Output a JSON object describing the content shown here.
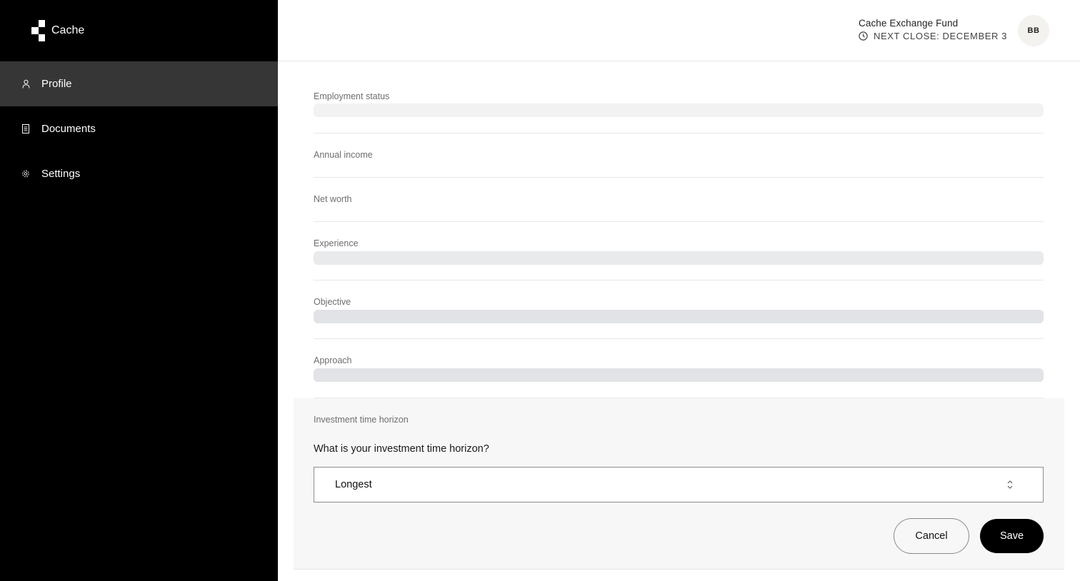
{
  "app": {
    "name": "Cache"
  },
  "sidebar": {
    "items": [
      {
        "label": "Profile",
        "icon": "person-icon",
        "active": true
      },
      {
        "label": "Documents",
        "icon": "document-icon",
        "active": false
      },
      {
        "label": "Settings",
        "icon": "gear-icon",
        "active": false
      }
    ]
  },
  "header": {
    "fund_name": "Cache Exchange Fund",
    "next_close": "NEXT CLOSE: DECEMBER 3",
    "avatar_initials": "BB"
  },
  "form": {
    "fields": [
      {
        "label": "Employment status",
        "loading": true
      },
      {
        "label": "Annual income",
        "loading": false
      },
      {
        "label": "Net worth",
        "loading": false
      },
      {
        "label": "Experience",
        "loading": true
      },
      {
        "label": "Objective",
        "loading": true
      },
      {
        "label": "Approach",
        "loading": true
      }
    ],
    "editing": {
      "label": "Investment time horizon",
      "question": "What is your investment time horizon?",
      "selected_value": "Longest",
      "cancel_label": "Cancel",
      "save_label": "Save"
    }
  },
  "colors": {
    "sidebar_bg": "#000000",
    "sidebar_active": "#363636",
    "skeleton_light": "#f2f2f2",
    "skeleton_dark": "#e1e3e6",
    "panel_bg": "#f7f7f7",
    "primary_button": "#000000"
  }
}
